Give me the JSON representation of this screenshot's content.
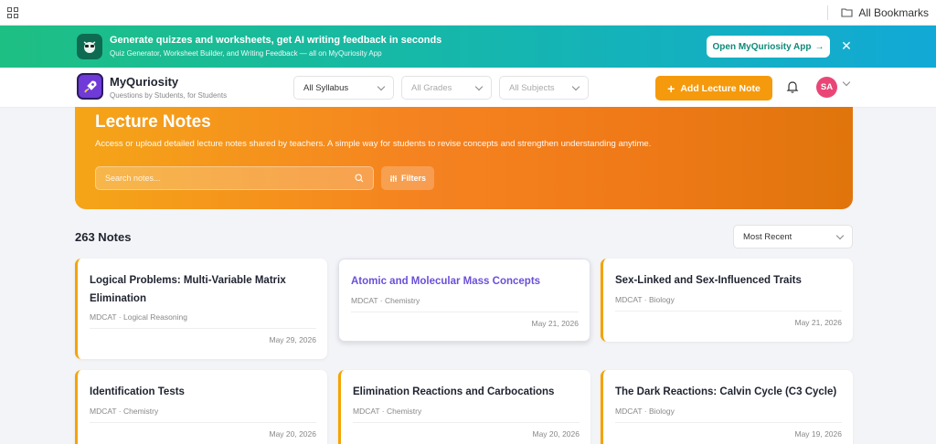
{
  "bookmarks": {
    "all_bookmarks": "All Bookmarks"
  },
  "promo": {
    "title": "Generate quizzes and worksheets, get AI writing feedback in seconds",
    "subtitle": "Quiz Generator, Worksheet Builder, and Writing Feedback — all on MyQuriosity App",
    "button": "Open MyQuriosity App",
    "button_arrow": "→",
    "close": "✕"
  },
  "header": {
    "brand": "MyQuriosity",
    "tagline": "Questions by Students, for Students",
    "syllabus": "All Syllabus",
    "grades": "All Grades",
    "subjects": "All Subjects",
    "add_button": "Add Lecture Note",
    "avatar": "SA"
  },
  "hero": {
    "title": "Lecture Notes",
    "description": "Access or upload detailed lecture notes shared by teachers. A simple way for students to revise concepts and strengthen understanding anytime.",
    "search_placeholder": "Search notes...",
    "filters": "Filters"
  },
  "list": {
    "count": "263 Notes",
    "sort": "Most Recent"
  },
  "notes": [
    {
      "title": "Logical Problems: Multi-Variable Matrix Elimination",
      "meta": "MDCAT · Logical Reasoning",
      "date": "May 29, 2026"
    },
    {
      "title": "Atomic and Molecular Mass Concepts",
      "meta": "MDCAT · Chemistry",
      "date": "May 21, 2026"
    },
    {
      "title": "Sex-Linked and Sex-Influenced Traits",
      "meta": "MDCAT · Biology",
      "date": "May 21, 2026"
    },
    {
      "title": "Identification Tests",
      "meta": "MDCAT · Chemistry",
      "date": "May 20, 2026"
    },
    {
      "title": "Elimination Reactions and Carbocations",
      "meta": "MDCAT · Chemistry",
      "date": "May 20, 2026"
    },
    {
      "title": "The Dark Reactions: Calvin Cycle (C3 Cycle)",
      "meta": "MDCAT · Biology",
      "date": "May 19, 2026"
    }
  ],
  "colors": {
    "accent": "#f59a0c",
    "brand_purple": "#6f3ad8",
    "link": "#6b4fd8"
  }
}
